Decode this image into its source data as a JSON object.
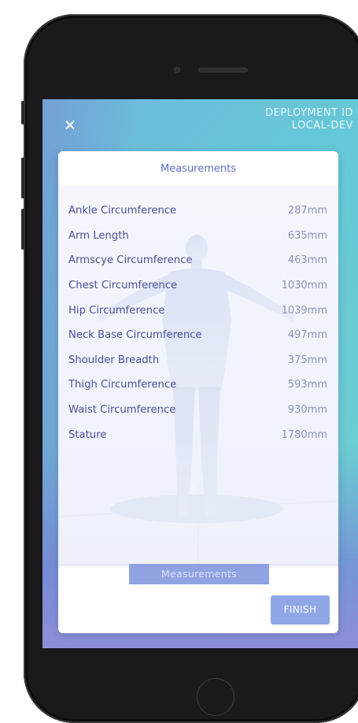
{
  "header": {
    "deployment_label": "DEPLOYMENT ID",
    "deployment_value": "LOCAL-DEV",
    "close_symbol": "✕"
  },
  "card": {
    "title": "Measurements",
    "tab_label": "Measurements",
    "finish_label": "FINISH"
  },
  "measurements": [
    {
      "name": "Ankle Circumference",
      "value": "287mm"
    },
    {
      "name": "Arm Length",
      "value": "635mm"
    },
    {
      "name": "Armscye Circumference",
      "value": "463mm"
    },
    {
      "name": "Chest Circumference",
      "value": "1030mm"
    },
    {
      "name": "Hip Circumference",
      "value": "1039mm"
    },
    {
      "name": "Neck Base Circumference",
      "value": "497mm"
    },
    {
      "name": "Shoulder Breadth",
      "value": "375mm"
    },
    {
      "name": "Thigh Circumference",
      "value": "593mm"
    },
    {
      "name": "Waist Circumference",
      "value": "930mm"
    },
    {
      "name": "Stature",
      "value": "1780mm"
    }
  ],
  "colors": {
    "accent": "#8fa7e6",
    "title_text": "#5a6cc4",
    "label_text": "#4a4e96",
    "value_text": "#8b90b8"
  }
}
